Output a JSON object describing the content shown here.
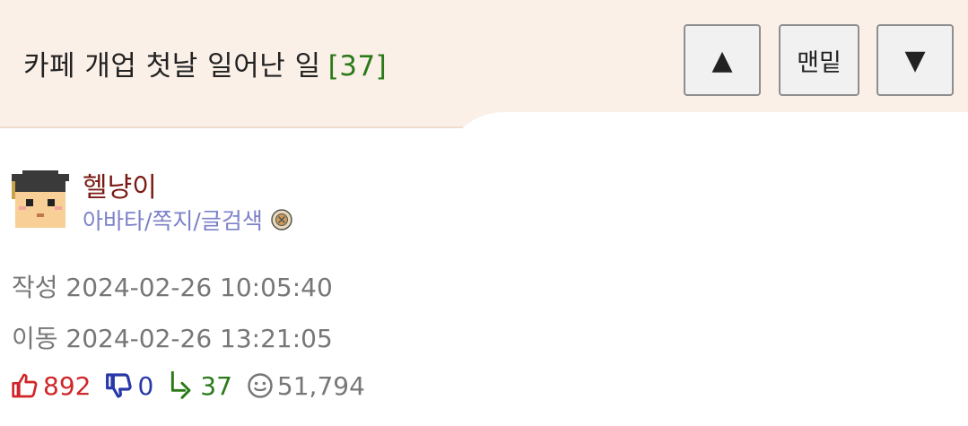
{
  "header": {
    "title": "카페 개업 첫날 일어난 일",
    "comment_count": "[37]",
    "buttons": {
      "up_label": "▲",
      "bottom_label": "맨밑",
      "down_label": "▼"
    }
  },
  "author": {
    "nickname": "헬냥이",
    "links": "아바타/쪽지/글검색"
  },
  "meta": {
    "created": "작성 2024-02-26 10:05:40",
    "moved": "이동 2024-02-26 13:21:05"
  },
  "stats": {
    "likes": "892",
    "dislikes": "0",
    "replies": "37",
    "views": "51,794"
  },
  "icons": {
    "like": "thumbs-up-icon",
    "dislike": "thumbs-down-icon",
    "reply": "reply-arrow-icon",
    "view": "smiley-view-icon",
    "badge": "badge-icon",
    "avatar": "graduate-avatar"
  },
  "colors": {
    "header_bg": "#fbf0e8",
    "count_green": "#2a7a18",
    "nickname": "#7a1a14",
    "links": "#7c82c9",
    "like_red": "#d0262a",
    "dislike_blue": "#2838a8"
  }
}
